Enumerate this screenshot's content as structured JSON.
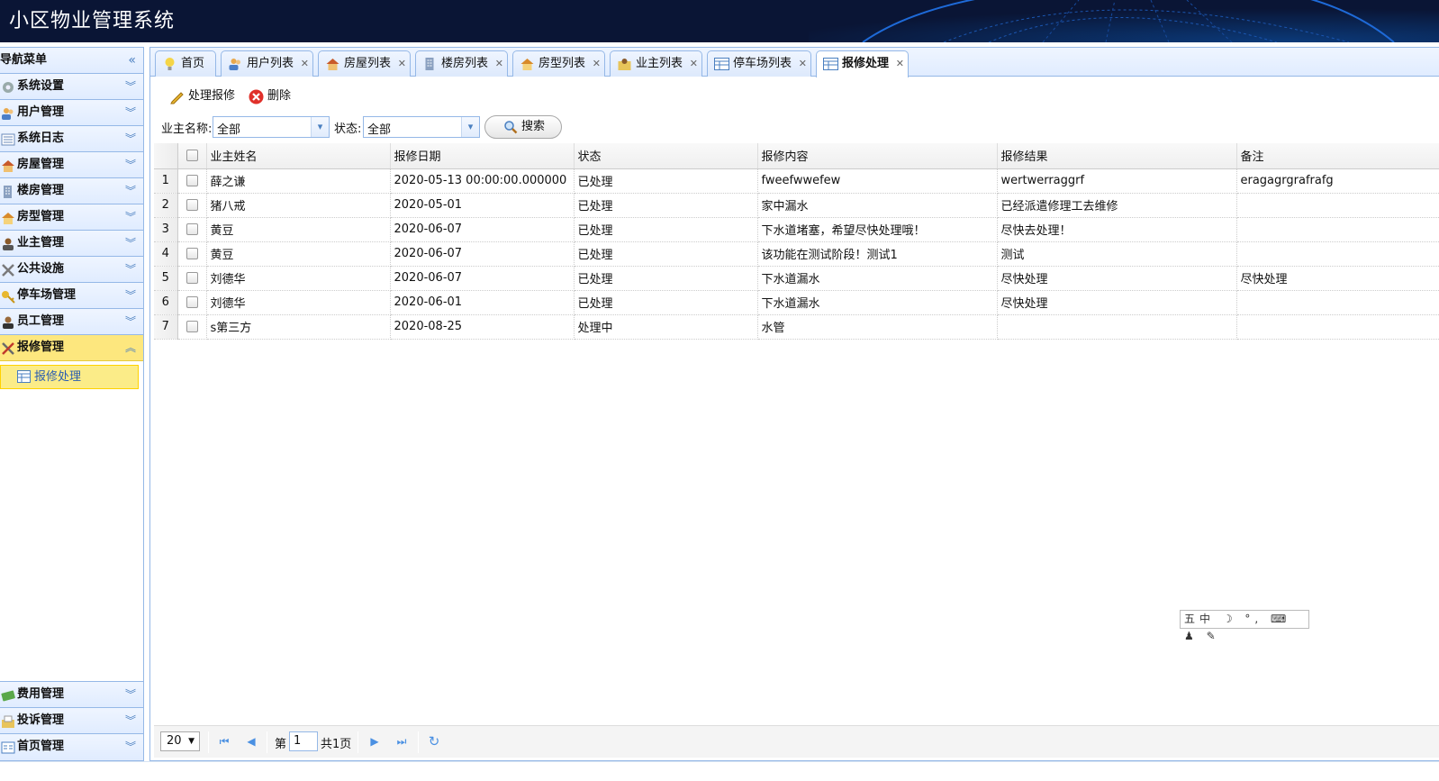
{
  "app": {
    "title": "小区物业管理系统"
  },
  "sidebar": {
    "header": "导航菜单",
    "collapse_icon": "double-chevron-left-icon",
    "items": [
      {
        "label": "系统设置",
        "icon": "gear-icon"
      },
      {
        "label": "用户管理",
        "icon": "users-icon"
      },
      {
        "label": "系统日志",
        "icon": "log-icon"
      },
      {
        "label": "房屋管理",
        "icon": "house-icon"
      },
      {
        "label": "楼房管理",
        "icon": "building-icon"
      },
      {
        "label": "房型管理",
        "icon": "house-type-icon"
      },
      {
        "label": "业主管理",
        "icon": "owner-icon"
      },
      {
        "label": "公共设施",
        "icon": "tools-icon"
      },
      {
        "label": "停车场管理",
        "icon": "key-icon"
      },
      {
        "label": "员工管理",
        "icon": "staff-icon"
      },
      {
        "label": "报修管理",
        "icon": "repair-icon",
        "active": true
      }
    ],
    "active_sub": "报修处理",
    "bottom_items": [
      {
        "label": "费用管理",
        "icon": "money-icon"
      },
      {
        "label": "投诉管理",
        "icon": "complaint-icon"
      },
      {
        "label": "首页管理",
        "icon": "homepage-icon"
      }
    ]
  },
  "tabs": [
    {
      "label": "首页",
      "closable": false,
      "icon": "bulb-icon"
    },
    {
      "label": "用户列表",
      "closable": true,
      "icon": "users-icon"
    },
    {
      "label": "房屋列表",
      "closable": true,
      "icon": "house-icon"
    },
    {
      "label": "楼房列表",
      "closable": true,
      "icon": "building-icon"
    },
    {
      "label": "房型列表",
      "closable": true,
      "icon": "house-type-icon"
    },
    {
      "label": "业主列表",
      "closable": true,
      "icon": "owner-icon"
    },
    {
      "label": "停车场列表",
      "closable": true,
      "icon": "table-icon"
    },
    {
      "label": "报修处理",
      "closable": true,
      "icon": "table-icon",
      "selected": true
    }
  ],
  "toolbar": {
    "handle_label": "处理报修",
    "delete_label": "删除"
  },
  "filter": {
    "owner_label": "业主名称:",
    "owner_value": "全部",
    "status_label": "状态:",
    "status_value": "全部",
    "search_label": "搜索"
  },
  "grid": {
    "columns": [
      "业主姓名",
      "报修日期",
      "状态",
      "报修内容",
      "报修结果",
      "备注"
    ],
    "rows": [
      [
        "薛之谦",
        "2020-05-13 00:00:00.000000",
        "已处理",
        "fweefwwefew",
        "wertwerraggrf",
        "eragagrgrafrafg"
      ],
      [
        "猪八戒",
        "2020-05-01",
        "已处理",
        "家中漏水",
        "已经派遣修理工去维修",
        ""
      ],
      [
        "黄豆",
        "2020-06-07",
        "已处理",
        "下水道堵塞，希望尽快处理哦！",
        "尽快去处理！",
        ""
      ],
      [
        "黄豆",
        "2020-06-07",
        "已处理",
        "该功能在测试阶段！测试1",
        "测试",
        ""
      ],
      [
        "刘德华",
        "2020-06-07",
        "已处理",
        "下水道漏水",
        "尽快处理",
        "尽快处理"
      ],
      [
        "刘德华",
        "2020-06-01",
        "已处理",
        "下水道漏水",
        "尽快处理",
        ""
      ],
      [
        "s第三方",
        "2020-08-25",
        "处理中",
        "水管",
        "",
        ""
      ]
    ]
  },
  "pager": {
    "page_size": "20",
    "page_prefix": "第",
    "page_value": "1",
    "page_total": "共1页"
  },
  "ime_bar": "五中",
  "colors": {
    "header_bg": "#0a1535",
    "accent": "#95b8e7",
    "active_menu": "#fde77e"
  }
}
